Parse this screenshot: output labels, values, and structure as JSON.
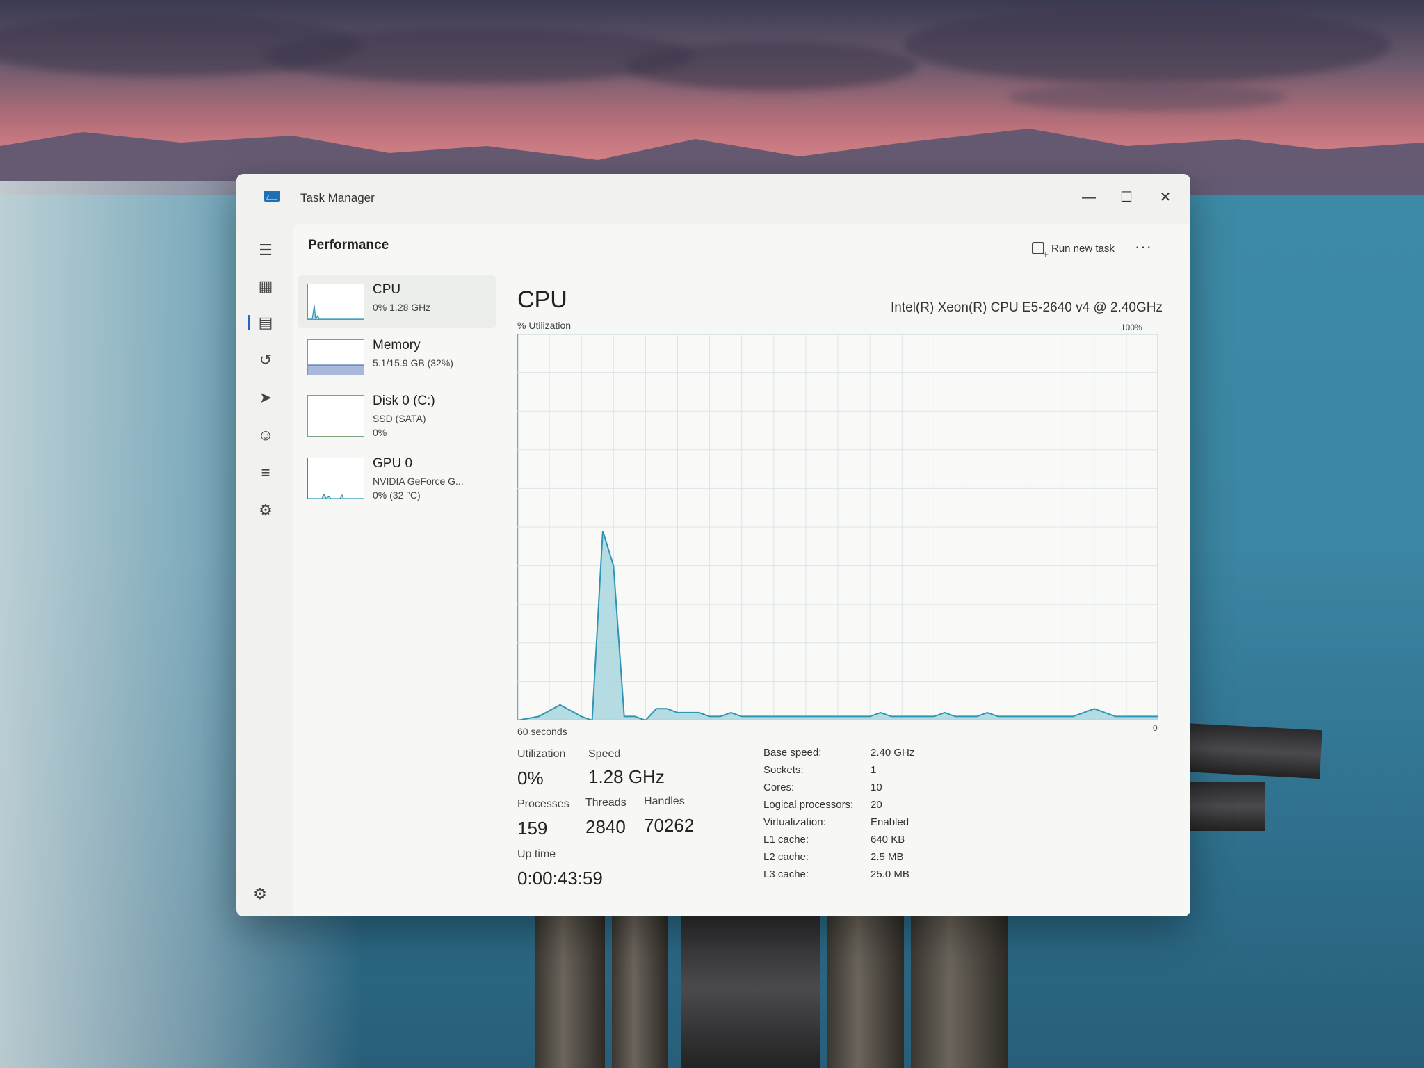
{
  "window": {
    "title": "Task Manager",
    "minimize_icon": "minimize-icon",
    "maximize_icon": "maximize-icon",
    "close_icon": "close-icon"
  },
  "nav": {
    "items": [
      {
        "name": "hamburger-menu-icon"
      },
      {
        "name": "processes-icon"
      },
      {
        "name": "performance-icon",
        "active": true
      },
      {
        "name": "app-history-icon"
      },
      {
        "name": "startup-apps-icon"
      },
      {
        "name": "users-icon"
      },
      {
        "name": "details-icon"
      },
      {
        "name": "services-icon"
      }
    ],
    "settings_icon": "settings-icon"
  },
  "header": {
    "title": "Performance",
    "run_new_task_label": "Run new task",
    "more_label": "···"
  },
  "resources": [
    {
      "name": "CPU",
      "lines": [
        "0% 1.28 GHz"
      ]
    },
    {
      "name": "Memory",
      "lines": [
        "5.1/15.9 GB (32%)"
      ]
    },
    {
      "name": "Disk 0 (C:)",
      "lines": [
        "SSD (SATA)",
        "0%"
      ]
    },
    {
      "name": "GPU 0",
      "lines": [
        "NVIDIA GeForce G...",
        "0% (32 °C)"
      ]
    }
  ],
  "main": {
    "heading": "CPU",
    "model": "Intel(R) Xeon(R) CPU E5-2640 v4 @ 2.40GHz",
    "graph_label_top_left": "% Utilization",
    "graph_label_top_right": "100%",
    "graph_label_bottom_left": "60 seconds",
    "graph_label_bottom_right": "0",
    "stats": {
      "utilization_label": "Utilization",
      "utilization_value": "0%",
      "speed_label": "Speed",
      "speed_value": "1.28 GHz",
      "processes_label": "Processes",
      "processes_value": "159",
      "threads_label": "Threads",
      "threads_value": "2840",
      "handles_label": "Handles",
      "handles_value": "70262",
      "uptime_label": "Up time",
      "uptime_value": "0:00:43:59"
    },
    "specs": [
      {
        "label": "Base speed:",
        "value": "2.40 GHz"
      },
      {
        "label": "Sockets:",
        "value": "1"
      },
      {
        "label": "Cores:",
        "value": "10"
      },
      {
        "label": "Logical processors:",
        "value": "20"
      },
      {
        "label": "Virtualization:",
        "value": "Enabled"
      },
      {
        "label": "L1 cache:",
        "value": "640 KB"
      },
      {
        "label": "L2 cache:",
        "value": "2.5 MB"
      },
      {
        "label": "L3 cache:",
        "value": "25.0 MB"
      }
    ]
  },
  "chart_data": {
    "type": "area",
    "x": [
      0,
      2,
      4,
      6,
      7,
      8,
      9,
      10,
      11,
      12,
      13,
      14,
      15,
      16,
      17,
      18,
      19,
      20,
      21,
      22,
      23,
      24,
      25,
      26,
      27,
      28,
      29,
      30,
      31,
      32,
      33,
      34,
      35,
      36,
      37,
      38,
      39,
      40,
      41,
      42,
      43,
      44,
      45,
      46,
      47,
      48,
      49,
      50,
      51,
      52,
      53,
      54,
      55,
      56,
      57,
      58,
      59,
      60
    ],
    "series": [
      {
        "values": [
          0,
          1,
          4,
          1,
          0,
          49,
          40,
          1,
          1,
          0,
          3,
          3,
          2,
          2,
          2,
          1,
          1,
          2,
          1,
          1,
          1,
          1,
          1,
          1,
          1,
          1,
          1,
          1,
          1,
          1,
          1,
          2,
          1,
          1,
          1,
          1,
          1,
          2,
          1,
          1,
          1,
          2,
          1,
          1,
          1,
          1,
          1,
          1,
          1,
          1,
          2,
          3,
          2,
          1,
          1,
          1,
          1,
          1
        ]
      }
    ],
    "ylim": [
      0,
      100
    ],
    "xlim": [
      0,
      60
    ],
    "grid": true,
    "accent": "#2f95b5",
    "fill": "#a9d6df"
  }
}
